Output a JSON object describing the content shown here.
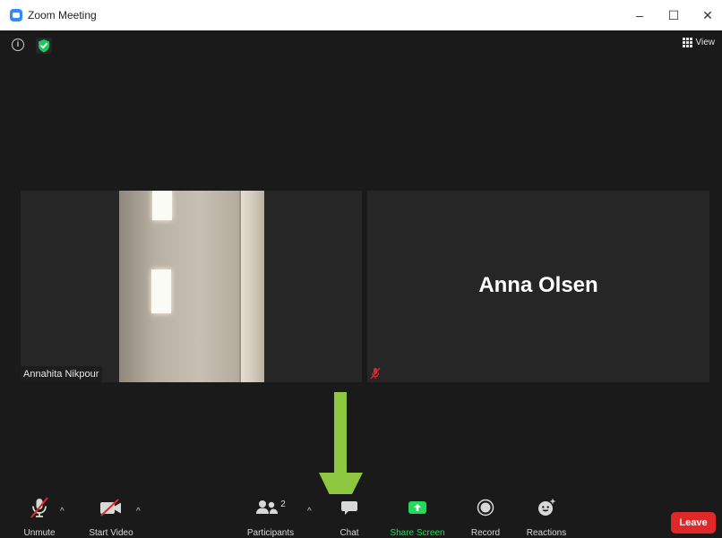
{
  "window": {
    "title": "Zoom Meeting",
    "controls": {
      "minimize": "–",
      "maximize": "☐",
      "close": "✕"
    }
  },
  "top_bar": {
    "info_glyph": "i",
    "view_label": "View"
  },
  "participants_view": {
    "tiles": [
      {
        "name": "Annahita Nikpour",
        "video_on": true
      },
      {
        "name": "Anna Olsen",
        "video_on": false,
        "muted": true
      }
    ]
  },
  "toolbar": {
    "unmute": "Unmute",
    "start_video": "Start Video",
    "participants": "Participants",
    "participants_count": "2",
    "chat": "Chat",
    "share_screen": "Share Screen",
    "record": "Record",
    "reactions": "Reactions",
    "leave": "Leave"
  },
  "colors": {
    "share_accent": "#23d959",
    "leave_red": "#e02828",
    "arrow_green": "#8dc63f",
    "shield_green": "#22c55e"
  },
  "icons": [
    "zoom-logo-icon",
    "info-icon",
    "shield-check-icon",
    "grid-view-icon",
    "mic-off-icon",
    "video-off-icon",
    "participants-icon",
    "chat-icon",
    "share-screen-icon",
    "record-icon",
    "reactions-icon",
    "caret-up-icon",
    "down-arrow-annotation"
  ]
}
